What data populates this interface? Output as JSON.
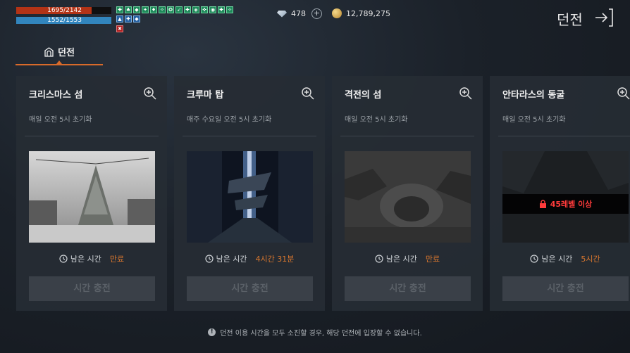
{
  "status": {
    "hp": {
      "text": "1695/2142",
      "fraction": 0.7913
    },
    "mp": {
      "text": "1552/1553",
      "fraction": 0.9994
    }
  },
  "currency": {
    "gems": "478",
    "gold": "12,789,275"
  },
  "header": {
    "title": "던전"
  },
  "tabs": [
    {
      "label": "던전",
      "active": true
    }
  ],
  "dungeons": [
    {
      "name": "크리스마스 섬",
      "reset": "매일 오전 5시 초기화",
      "time_label": "남은 시간",
      "time_value": "만료",
      "locked": false,
      "lock_text": "",
      "button": "시간 충전"
    },
    {
      "name": "크루마 탑",
      "reset": "매주 수요일 오전 5시 초기화",
      "time_label": "남은 시간",
      "time_value": "4시간 31분",
      "locked": false,
      "lock_text": "",
      "button": "시간 충전"
    },
    {
      "name": "격전의 섬",
      "reset": "매일 오전 5시 초기화",
      "time_label": "남은 시간",
      "time_value": "만료",
      "locked": false,
      "lock_text": "",
      "button": "시간 충전"
    },
    {
      "name": "안타라스의 동굴",
      "reset": "매일 오전 5시 초기화",
      "time_label": "남은 시간",
      "time_value": "5시간",
      "locked": true,
      "lock_text": "45레벨 이상",
      "button": "시간 충전"
    }
  ],
  "footer": {
    "notice": "던전 이용 시간을 모두 소진할 경우, 해당 던전에 입장할 수 없습니다."
  },
  "colors": {
    "accent": "#d86a2a",
    "hp": "#b33316",
    "mp": "#3285bd",
    "lock": "#ff3b3b"
  }
}
